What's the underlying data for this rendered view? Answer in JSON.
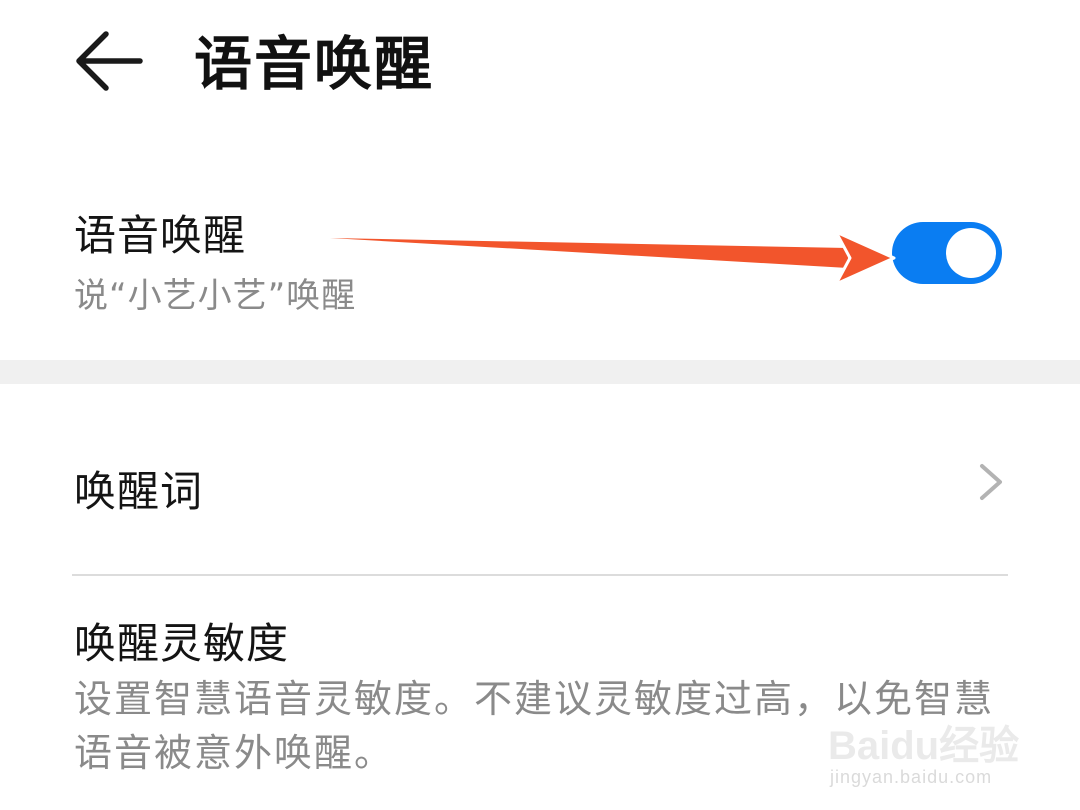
{
  "header": {
    "title": "语音唤醒",
    "back_icon": "arrow-left-icon"
  },
  "voice_wake": {
    "title": "语音唤醒",
    "subtitle": "说“小艺小艺”唤醒",
    "toggle_on": true,
    "toggle_color": "#0a7df2"
  },
  "annotation": {
    "arrow_color": "#f2552c"
  },
  "wake_word": {
    "title": "唤醒词",
    "chevron_icon": "chevron-right-icon"
  },
  "sensitivity": {
    "title": "唤醒灵敏度",
    "description": "设置智慧语音灵敏度。不建议灵敏度过高，以免智慧语音被意外唤醒。"
  },
  "watermark": {
    "brand": "Baidu经验",
    "url": "jingyan.baidu.com"
  }
}
